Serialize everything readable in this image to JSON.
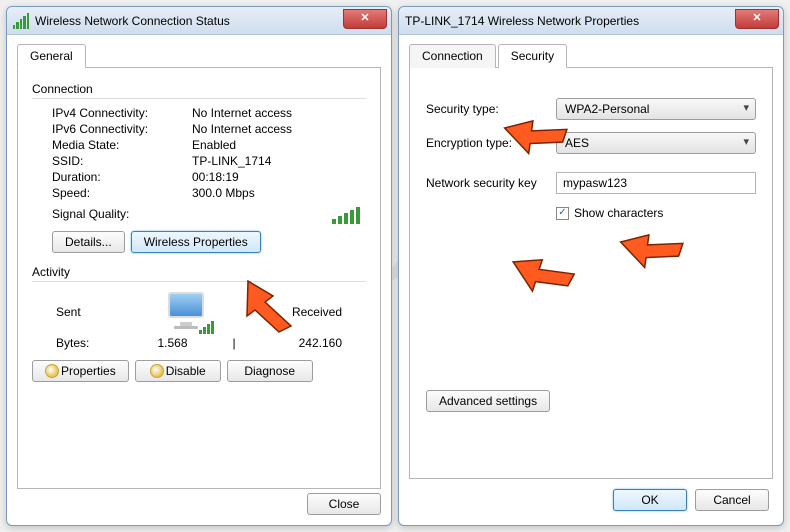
{
  "watermark": "pcrisk.com",
  "left": {
    "title": "Wireless Network Connection Status",
    "tab_general": "General",
    "group_connection": "Connection",
    "ipv4_lbl": "IPv4 Connectivity:",
    "ipv4_val": "No Internet access",
    "ipv6_lbl": "IPv6 Connectivity:",
    "ipv6_val": "No Internet access",
    "media_lbl": "Media State:",
    "media_val": "Enabled",
    "ssid_lbl": "SSID:",
    "ssid_val": "TP-LINK_1714",
    "duration_lbl": "Duration:",
    "duration_val": "00:18:19",
    "speed_lbl": "Speed:",
    "speed_val": "300.0 Mbps",
    "signal_lbl": "Signal Quality:",
    "details_btn": "Details...",
    "wprops_btn": "Wireless Properties",
    "group_activity": "Activity",
    "sent": "Sent",
    "received": "Received",
    "bytes_lbl": "Bytes:",
    "bytes_sent": "1.568",
    "bytes_recv": "242.160",
    "properties_btn": "Properties",
    "disable_btn": "Disable",
    "diagnose_btn": "Diagnose",
    "close_btn": "Close"
  },
  "right": {
    "title": "TP-LINK_1714 Wireless Network Properties",
    "tab_connection": "Connection",
    "tab_security": "Security",
    "sectype_lbl": "Security type:",
    "sectype_val": "WPA2-Personal",
    "enctype_lbl": "Encryption type:",
    "enctype_val": "AES",
    "key_lbl": "Network security key",
    "key_val": "mypasw123",
    "showchars_lbl": "Show characters",
    "showchars_checked": true,
    "advanced_btn": "Advanced settings",
    "ok_btn": "OK",
    "cancel_btn": "Cancel"
  }
}
